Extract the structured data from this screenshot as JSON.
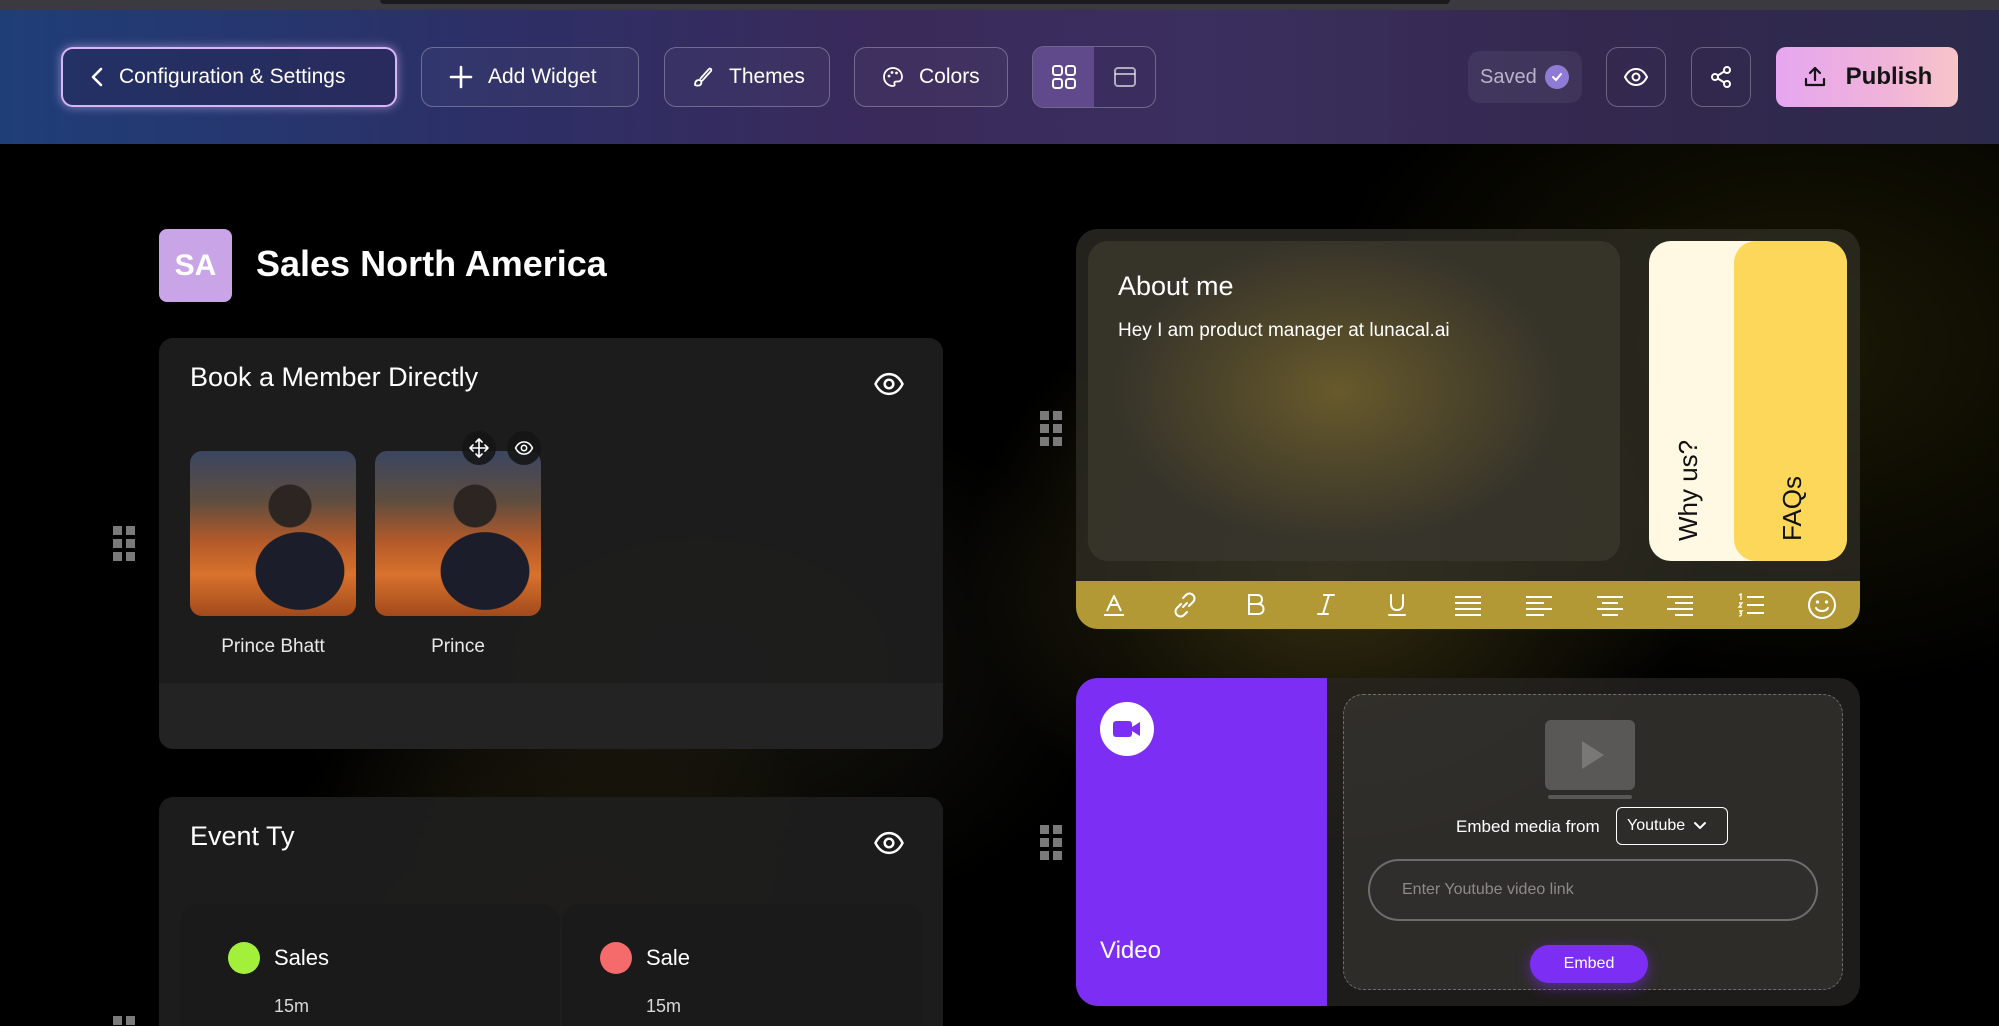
{
  "header": {
    "config_label": "Configuration & Settings",
    "add_widget_label": "Add Widget",
    "themes_label": "Themes",
    "colors_label": "Colors",
    "saved_label": "Saved",
    "publish_label": "Publish"
  },
  "org": {
    "initials": "SA",
    "name": "Sales North America"
  },
  "book_card": {
    "title": "Book a Member Directly",
    "members": [
      {
        "name": "Prince Bhatt"
      },
      {
        "name": "Prince"
      }
    ]
  },
  "event_card": {
    "title": "Event Ty",
    "events": [
      {
        "name": "Sales",
        "duration": "15m",
        "color": "#a3f03a"
      },
      {
        "name": "Sale",
        "duration": "15m",
        "color": "#f56a6a"
      }
    ]
  },
  "about": {
    "title": "About me",
    "text": "Hey I am product manager at lunacal.ai",
    "tabs": [
      "Why us?",
      "FAQs"
    ]
  },
  "video": {
    "label": "Video",
    "embed_label": "Embed media from",
    "source_selected": "Youtube",
    "input_placeholder": "Enter Youtube video link",
    "embed_button": "Embed"
  },
  "colors": {
    "accent_purple": "#7d2ef5",
    "publish_gradient_start": "#e6a6f0",
    "toolbar_gold": "#b39836",
    "faq_yellow": "#fcd75a"
  }
}
